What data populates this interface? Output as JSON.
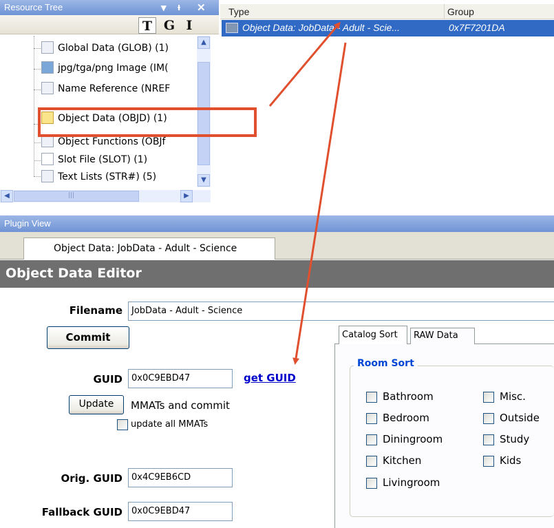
{
  "resource_tree": {
    "title": "Resource Tree",
    "controls": [
      "▾",
      "ᵼ",
      "✕"
    ],
    "tgi_buttons": [
      "T",
      "G",
      "I"
    ],
    "items": [
      "Global Data (GLOB) (1)",
      "jpg/tga/png Image (IM(",
      "Name Reference (NREF",
      "Object Data (OBJD) (1)",
      "Object Functions (OBJf",
      "Slot File (SLOT) (1)",
      "Text Lists (STR#) (5)"
    ],
    "hscroll_marks": "|||"
  },
  "list_view": {
    "columns": [
      "Type",
      "Group"
    ],
    "rows": [
      {
        "type": "Object Data: JobData - Adult - Scie...",
        "group": "0x7F7201DA"
      }
    ]
  },
  "plugin_view": {
    "title": "Plugin View",
    "tab_label": "Object Data: JobData - Adult - Science"
  },
  "editor": {
    "header": "Object Data Editor",
    "filename_label": "Filename",
    "filename_value": "JobData - Adult - Science",
    "commit_label": "Commit",
    "guid_label": "GUID",
    "guid_value": "0x0C9EBD47",
    "get_guid_link": "get GUID",
    "update_label": "Update",
    "mmats_text": "MMATs and commit",
    "update_all_label": "update all MMATs",
    "orig_guid_label": "Orig. GUID",
    "orig_guid_value": "0x4C9EB6CD",
    "fallback_guid_label": "Fallback GUID",
    "fallback_guid_value": "0x0C9EBD47",
    "tabs": [
      "Catalog Sort",
      "RAW Data"
    ],
    "room_sort_label": "Room Sort",
    "rooms_left": [
      "Bathroom",
      "Bedroom",
      "Diningroom",
      "Kitchen",
      "Livingroom"
    ],
    "rooms_right": [
      "Misc.",
      "Outside",
      "Study",
      "Kids"
    ]
  },
  "colors": {
    "selection": "#316ac5",
    "annotation": "#e0502e",
    "link": "#0000cc",
    "titlebar": "#6f93d4"
  }
}
